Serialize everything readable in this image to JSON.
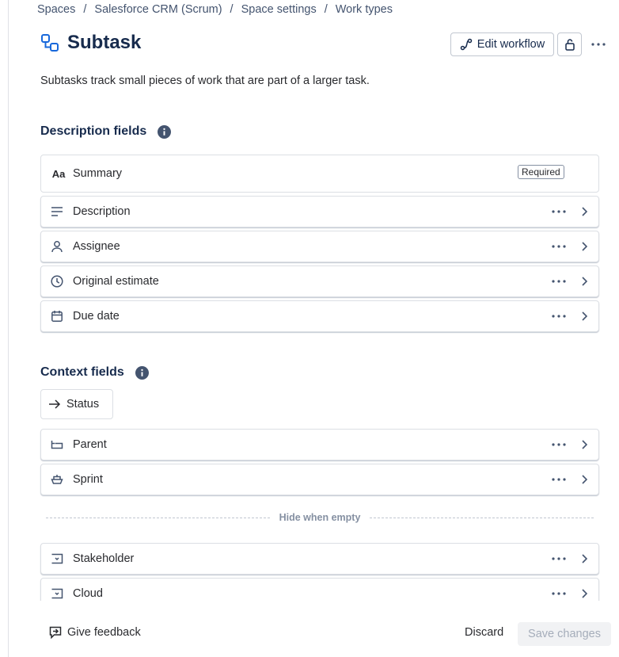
{
  "breadcrumb": [
    "Spaces",
    "Salesforce CRM (Scrum)",
    "Space settings",
    "Work types"
  ],
  "breadcrumb_separator": "/",
  "header": {
    "title": "Subtask",
    "title_icon": "subtask-icon",
    "edit_workflow_label": "Edit workflow",
    "accent_color": "#1868db"
  },
  "description": "Subtasks track small pieces of work that are part of a larger task.",
  "description_fields": {
    "heading": "Description fields",
    "items": [
      {
        "label": "Summary",
        "icon": "text-aa-icon",
        "badge": "Required"
      },
      {
        "label": "Description",
        "icon": "lines-icon"
      },
      {
        "label": "Assignee",
        "icon": "person-icon"
      },
      {
        "label": "Original estimate",
        "icon": "clock-icon"
      },
      {
        "label": "Due date",
        "icon": "calendar-icon"
      }
    ]
  },
  "context_fields": {
    "heading": "Context fields",
    "status_label": "Status",
    "items": [
      {
        "label": "Parent",
        "icon": "parent-icon"
      },
      {
        "label": "Sprint",
        "icon": "sprint-icon"
      }
    ],
    "hide_when_empty_label": "Hide when empty",
    "hidden_items": [
      {
        "label": "Stakeholder",
        "icon": "dropdown-field-icon"
      },
      {
        "label": "Cloud",
        "icon": "dropdown-field-icon"
      }
    ]
  },
  "footer": {
    "feedback_label": "Give feedback",
    "discard_label": "Discard",
    "save_label": "Save changes"
  }
}
